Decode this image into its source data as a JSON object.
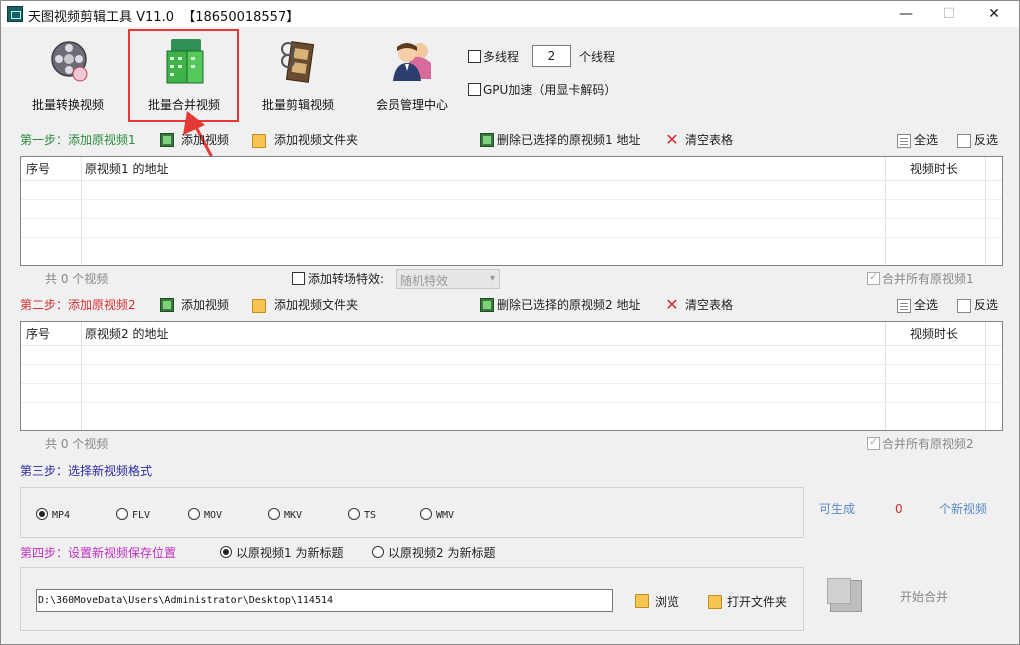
{
  "window": {
    "title": "天图视频剪辑工具 V11.0  【18650018557】",
    "minimize": "—",
    "maximize": "☐",
    "close": "✕"
  },
  "toolbar": {
    "items": [
      {
        "label": "批量转换视频",
        "icon": "film-reel-icon"
      },
      {
        "label": "批量合并视频",
        "icon": "merge-video-icon"
      },
      {
        "label": "批量剪辑视频",
        "icon": "film-strip-icon"
      },
      {
        "label": "会员管理中心",
        "icon": "members-icon"
      }
    ],
    "multithread_label": "多线程",
    "thread_count": "2",
    "thread_suffix": "个线程",
    "gpu_label": "GPU加速（用显卡解码）"
  },
  "step1": {
    "title": "第一步：添加原视频1",
    "add_video": "添加视频",
    "add_folder": "添加视频文件夹",
    "delete_selected": "删除已选择的原视频1 地址",
    "clear_table": "清空表格",
    "select_all": "全选",
    "invert": "反选",
    "columns": {
      "index": "序号",
      "path": "原视频1 的地址",
      "duration": "视频时长"
    },
    "count_text": "共 0 个视频",
    "transition_label": "添加转场特效:",
    "transition_value": "随机特效",
    "merge_all": "合并所有原视频1"
  },
  "step2": {
    "title": "第二步：添加原视频2",
    "add_video": "添加视频",
    "add_folder": "添加视频文件夹",
    "delete_selected": "删除已选择的原视频2 地址",
    "clear_table": "清空表格",
    "select_all": "全选",
    "invert": "反选",
    "columns": {
      "index": "序号",
      "path": "原视频2 的地址",
      "duration": "视频时长"
    },
    "count_text": "共 0 个视频",
    "merge_all": "合并所有原视频2"
  },
  "step3": {
    "title": "第三步：选择新视频格式",
    "formats": [
      "MP4",
      "FLV",
      "MOV",
      "MKV",
      "TS",
      "WMV"
    ],
    "selected": "MP4",
    "can_generate": "可生成",
    "count": "0",
    "suffix": "个新视频"
  },
  "step4": {
    "title": "第四步：设置新视频保存位置",
    "title_opt1": "以原视频1 为新标题",
    "title_opt2": "以原视频2 为新标题",
    "path": "D:\\360MoveData\\Users\\Administrator\\Desktop\\114514",
    "browse": "浏览",
    "open_folder": "打开文件夹",
    "start": "开始合并"
  },
  "colors": {
    "highlight": "#e53935",
    "step1": "#2a8a3a",
    "step2": "#d43030",
    "step3": "#2a2aa0",
    "step4": "#c02fc0"
  }
}
